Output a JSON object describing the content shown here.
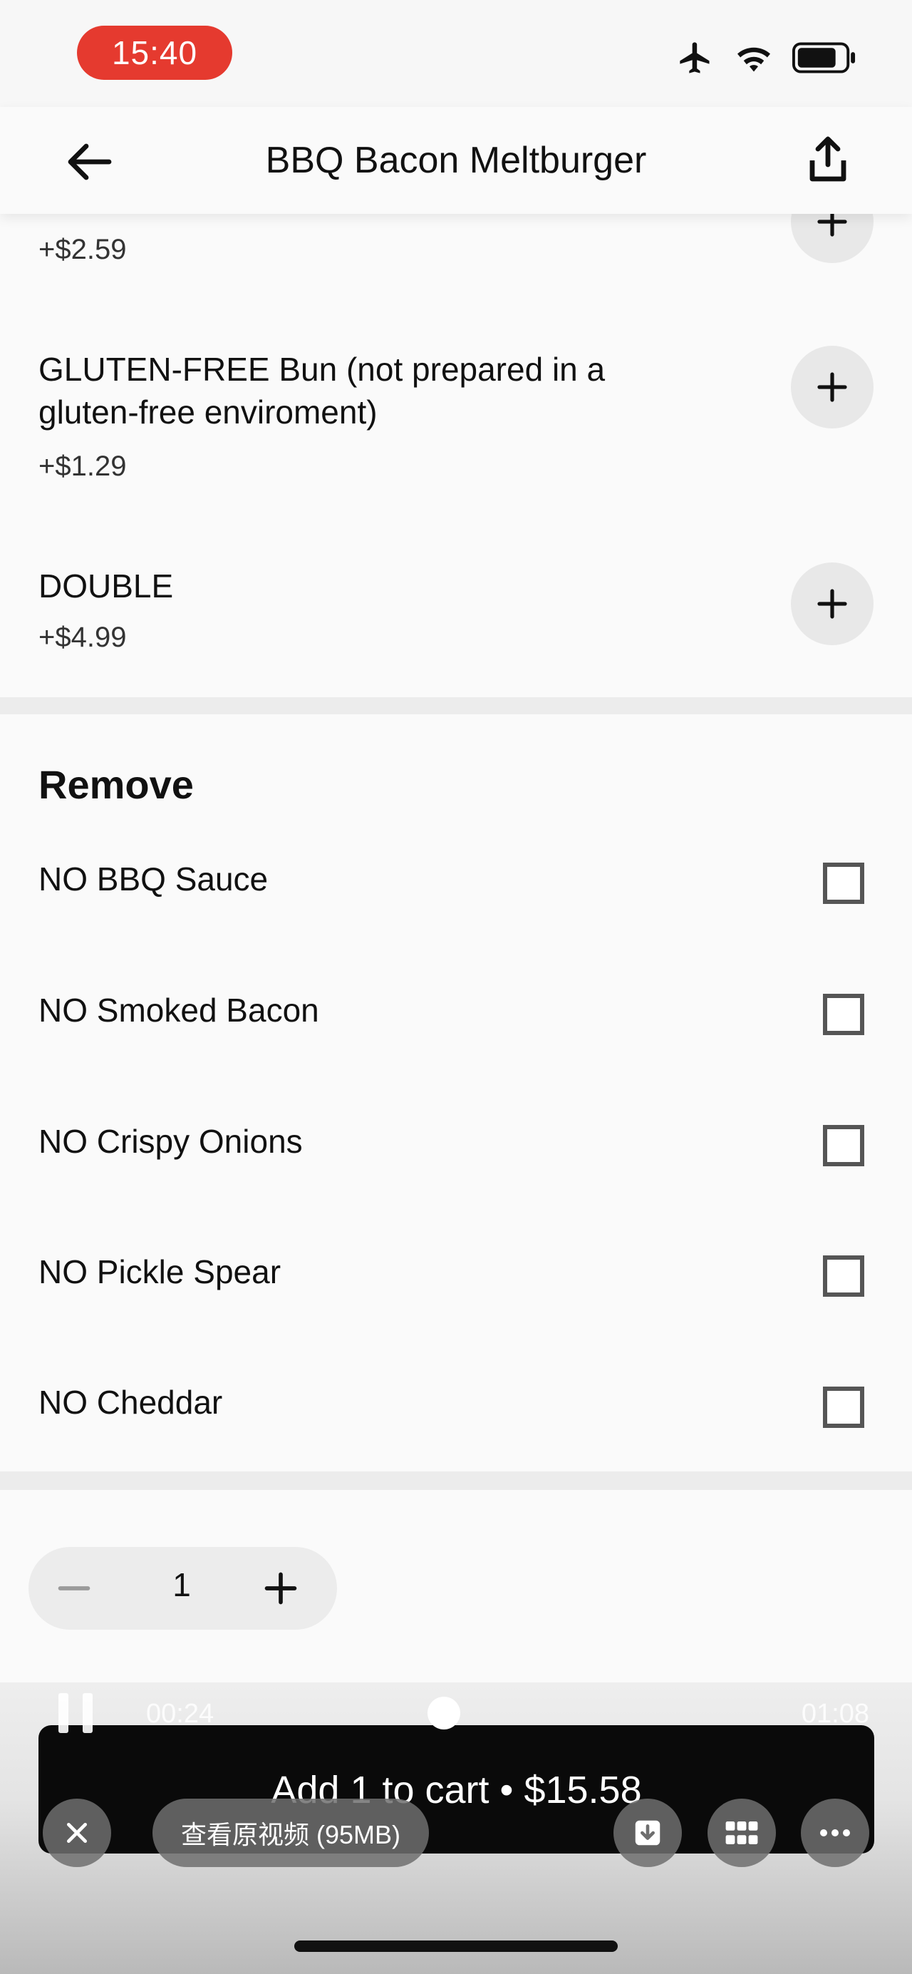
{
  "status_bar": {
    "time": "15:40",
    "icons": [
      "airplane-icon",
      "wifi-icon",
      "battery-icon"
    ]
  },
  "header": {
    "title": "BBQ Bacon Meltburger",
    "back_icon": "arrow-left-icon",
    "share_icon": "share-icon"
  },
  "addons": [
    {
      "label": "",
      "price": "+$2.59"
    },
    {
      "label": "GLUTEN-FREE Bun (not prepared in a gluten-free enviroment)",
      "price": "+$1.29"
    },
    {
      "label": "DOUBLE",
      "price": "+$4.99"
    }
  ],
  "remove": {
    "title": "Remove",
    "items": [
      "NO BBQ Sauce",
      "NO Smoked Bacon",
      "NO Crispy Onions",
      "NO Pickle Spear",
      "NO Cheddar"
    ]
  },
  "quantity": {
    "value": "1"
  },
  "cart_button": {
    "label": "Add 1 to cart • $15.58"
  },
  "player": {
    "current_time": "00:24",
    "total_time": "01:08",
    "view_original_label": "查看原视频 (95MB)",
    "colors": {
      "accent_red": "#e53a2f",
      "button_dark": "#0a0a0a"
    }
  }
}
